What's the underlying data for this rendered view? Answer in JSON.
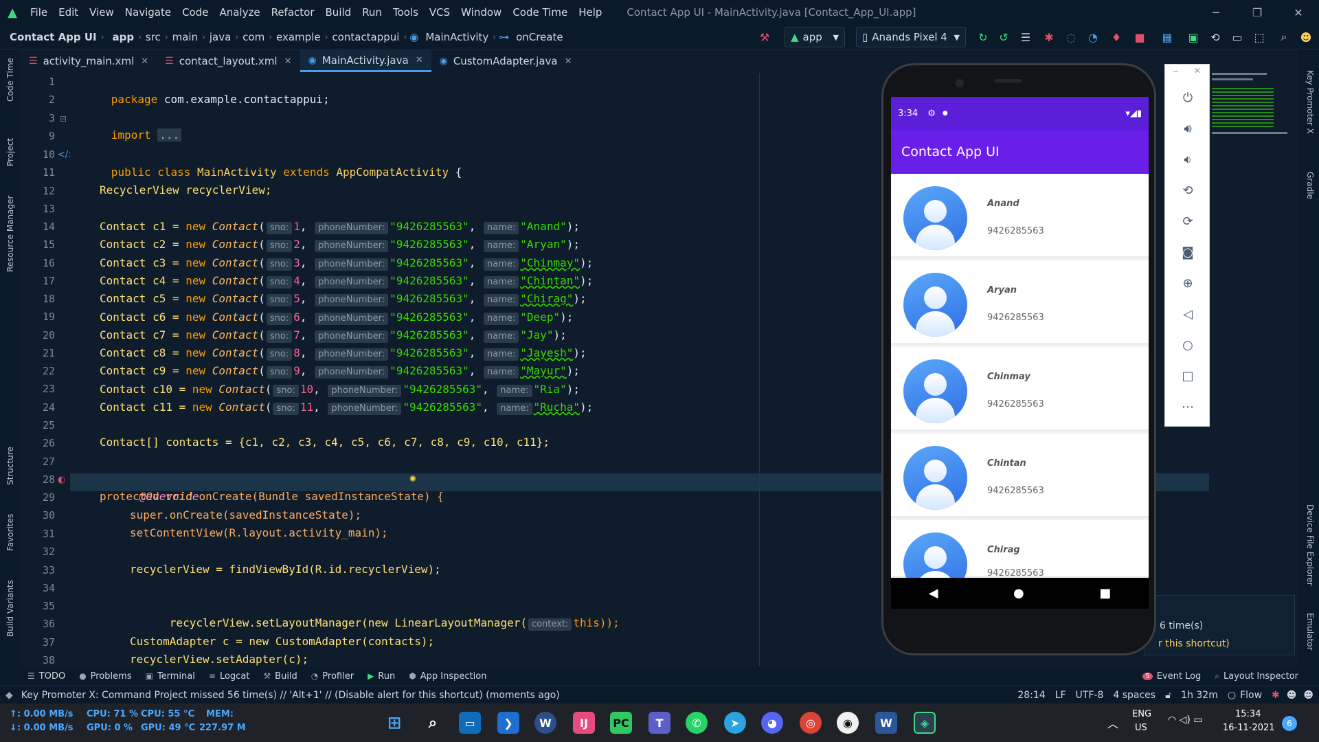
{
  "window": {
    "title": "Contact App UI - MainActivity.java [Contact_App_UI.app]"
  },
  "menu": [
    "File",
    "Edit",
    "View",
    "Navigate",
    "Code",
    "Analyze",
    "Refactor",
    "Build",
    "Run",
    "Tools",
    "VCS",
    "Window",
    "Code Time",
    "Help"
  ],
  "breadcrumb": {
    "project": "Contact App UI",
    "items": [
      "app",
      "src",
      "main",
      "java",
      "com",
      "example",
      "contactappui",
      "MainActivity",
      "onCreate"
    ]
  },
  "toolbar": {
    "run_config": "app",
    "device": "Anands Pixel 4"
  },
  "tabs": [
    {
      "label": "activity_main.xml",
      "active": false
    },
    {
      "label": "contact_layout.xml",
      "active": false
    },
    {
      "label": "MainActivity.java",
      "active": true
    },
    {
      "label": "CustomAdapter.java",
      "active": false
    }
  ],
  "left_tools": [
    "Code Time",
    "Project",
    "Resource Manager",
    "Structure",
    "Favorites",
    "Build Variants"
  ],
  "right_tools": [
    "Key Promoter X",
    "Gradle",
    "Device File Explorer",
    "Emulator"
  ],
  "editor": {
    "line_numbers": [
      "1",
      "2",
      "3",
      "9",
      "10",
      "11",
      "12",
      "13",
      "14",
      "15",
      "16",
      "17",
      "18",
      "19",
      "20",
      "21",
      "22",
      "23",
      "24",
      "25",
      "26",
      "27",
      "28",
      "29",
      "30",
      "31",
      "32",
      "33",
      "34",
      "35",
      "36",
      "37",
      "38"
    ],
    "package_kw": "package",
    "package_name": "com.example.contactappui;",
    "import_kw": "import",
    "import_fold": "...",
    "class_decl": [
      "public",
      "class",
      "MainActivity",
      "extends",
      "AppCompatActivity",
      "{"
    ],
    "field_line": "RecyclerView recyclerView;",
    "hint_sno": "sno:",
    "hint_phone": "phoneNumber:",
    "hint_name": "name:",
    "hint_context": "context:",
    "contacts": [
      {
        "var": "c1",
        "sno": "1",
        "phone": "\"9426285563\"",
        "name": "\"Anand\""
      },
      {
        "var": "c2",
        "sno": "2",
        "phone": "\"9426285563\"",
        "name": "\"Aryan\""
      },
      {
        "var": "c3",
        "sno": "3",
        "phone": "\"9426285563\"",
        "name": "\"Chinmay\""
      },
      {
        "var": "c4",
        "sno": "4",
        "phone": "\"9426285563\"",
        "name": "\"Chintan\""
      },
      {
        "var": "c5",
        "sno": "5",
        "phone": "\"9426285563\"",
        "name": "\"Chirag\""
      },
      {
        "var": "c6",
        "sno": "6",
        "phone": "\"9426285563\"",
        "name": "\"Deep\""
      },
      {
        "var": "c7",
        "sno": "7",
        "phone": "\"9426285563\"",
        "name": "\"Jay\""
      },
      {
        "var": "c8",
        "sno": "8",
        "phone": "\"9426285563\"",
        "name": "\"Jayesh\""
      },
      {
        "var": "c9",
        "sno": "9",
        "phone": "\"9426285563\"",
        "name": "\"Mayur\""
      },
      {
        "var": "c10",
        "sno": "10",
        "phone": "\"9426285563\"",
        "name": "\"Ria\""
      },
      {
        "var": "c11",
        "sno": "11",
        "phone": "\"9426285563\"",
        "name": "\"Rucha\""
      }
    ],
    "array_line": "Contact[] contacts = {c1, c2, c3, c4, c5, c6, c7, c8, c9, c10, c11};",
    "override": "@Override",
    "oncreate_sig": "protected void onCreate(Bundle savedInstanceState) {",
    "super_call": "super.onCreate(savedInstanceState);",
    "set_content": "setContentView(R.layout.activity_main);",
    "find_view": "recyclerView = findViewById(R.id.recyclerView);",
    "set_layout_pre": "recyclerView.setLayoutManager(new LinearLayoutManager(",
    "set_layout_post": "this));",
    "adapter_line": "CustomAdapter c = new CustomAdapter(contacts);",
    "set_adapter": "recyclerView.setAdapter(c);"
  },
  "phone": {
    "time": "3:34",
    "app_title": "Contact App UI",
    "contacts": [
      {
        "name": "Anand",
        "phone": "9426285563"
      },
      {
        "name": "Aryan",
        "phone": "9426285563"
      },
      {
        "name": "Chinmay",
        "phone": "9426285563"
      },
      {
        "name": "Chintan",
        "phone": "9426285563"
      },
      {
        "name": "Chirag",
        "phone": "9426285563"
      }
    ]
  },
  "notification_peek": {
    "line1": "6 time(s)",
    "line2": "r this shortcut)"
  },
  "tool_windows": [
    "TODO",
    "Problems",
    "Terminal",
    "Logcat",
    "Build",
    "Profiler",
    "Run",
    "App Inspection"
  ],
  "tool_windows_right": {
    "event_log": "Event Log",
    "event_count": "5",
    "layout_inspector": "Layout Inspector"
  },
  "status": {
    "message": "Key Promoter X: Command Project missed 56 time(s) // 'Alt+1' // (Disable alert for this shortcut) (moments ago)",
    "position": "28:14",
    "line_sep": "LF",
    "encoding": "UTF-8",
    "indent": "4 spaces",
    "time_spent": "1h 32m",
    "flow": "Flow"
  },
  "sysmon": {
    "up": "↑: 0.00 MB/s",
    "down": "↓: 0.00 MB/s",
    "cpu_load": "CPU: 71 %",
    "cpu_temp": "CPU: 55 °C",
    "mem": "MEM:",
    "gpu_load": "GPU: 0 %",
    "gpu_temp": "GPU: 49 °C",
    "mem_val": "227.97 M"
  },
  "taskbar": {
    "lang": "ENG",
    "region": "US",
    "time": "15:34",
    "date": "16-11-2021",
    "notif_count": "6"
  }
}
